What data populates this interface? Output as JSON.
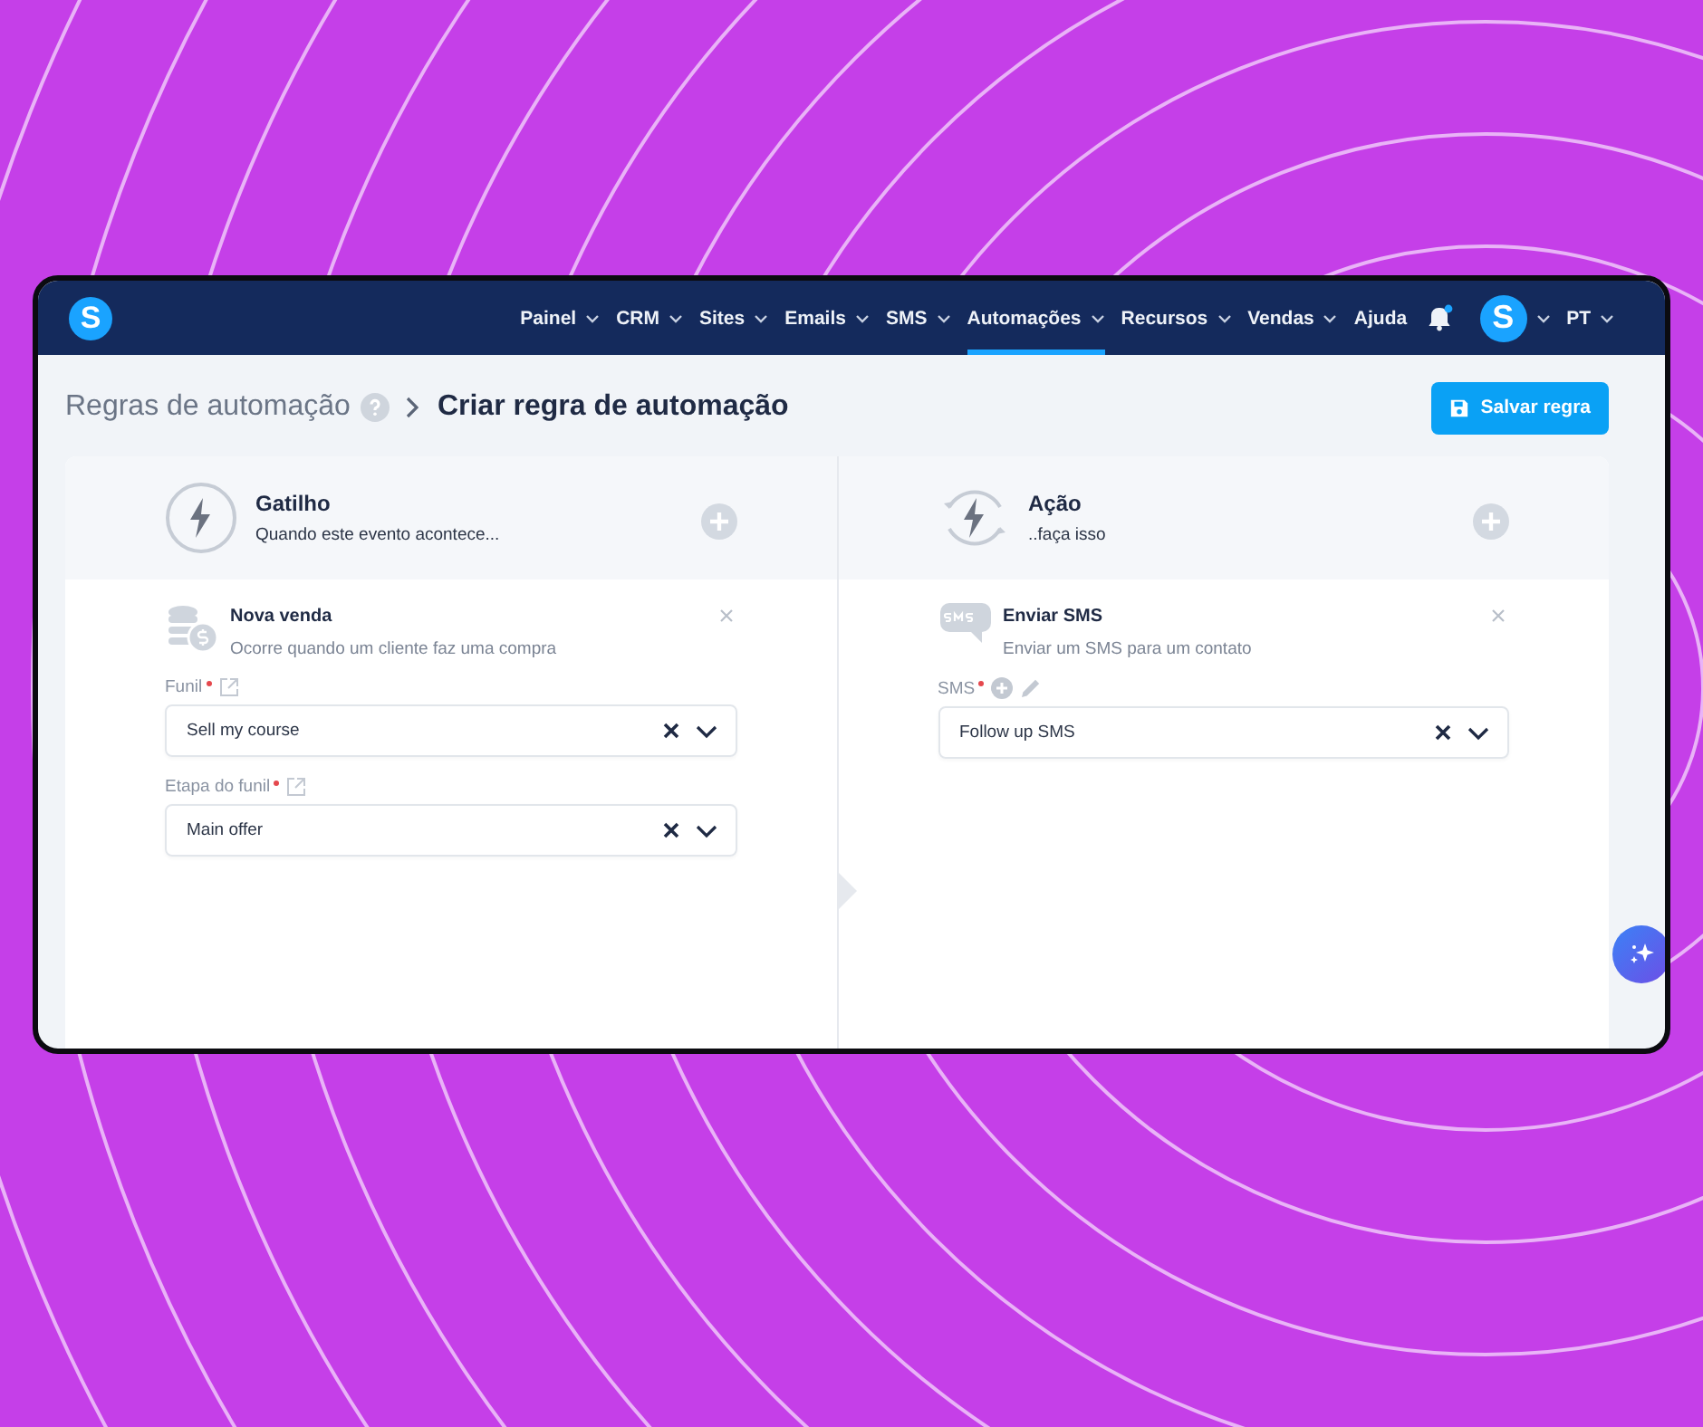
{
  "navbar": {
    "logo": "S",
    "items": [
      {
        "label": "Painel",
        "selected": false,
        "kind": "menu"
      },
      {
        "label": "CRM",
        "selected": false,
        "kind": "menu"
      },
      {
        "label": "Sites",
        "selected": false,
        "kind": "menu"
      },
      {
        "label": "Emails",
        "selected": false,
        "kind": "menu"
      },
      {
        "label": "SMS",
        "selected": false,
        "kind": "menu"
      },
      {
        "label": "Automações",
        "selected": true,
        "kind": "menu"
      },
      {
        "label": "Recursos",
        "selected": false,
        "kind": "menu"
      },
      {
        "label": "Vendas",
        "selected": false,
        "kind": "menu"
      },
      {
        "label": "Ajuda",
        "selected": false,
        "kind": "link"
      }
    ],
    "notification_dot": true,
    "avatar": "S",
    "language": "PT"
  },
  "breadcrumb": {
    "parent": "Regras de automação",
    "current": "Criar regra de automação"
  },
  "save_button": "Salvar regra",
  "panels": [
    {
      "kind": "trigger",
      "title": "Gatilho",
      "subtitle": "Quando este evento acontece...",
      "item": {
        "title": "Nova venda",
        "description": "Ocorre quando um cliente faz uma compra"
      },
      "fields": [
        {
          "label": "Funil",
          "required": true,
          "value": "Sell my course"
        },
        {
          "label": "Etapa do funil",
          "required": true,
          "value": "Main offer"
        }
      ]
    },
    {
      "kind": "action",
      "title": "Ação",
      "subtitle": "..faça isso",
      "item": {
        "title": "Enviar SMS",
        "description": "Enviar um SMS para um contato"
      },
      "fields": [
        {
          "label": "SMS",
          "required": true,
          "value": "Follow up SMS"
        }
      ]
    }
  ]
}
